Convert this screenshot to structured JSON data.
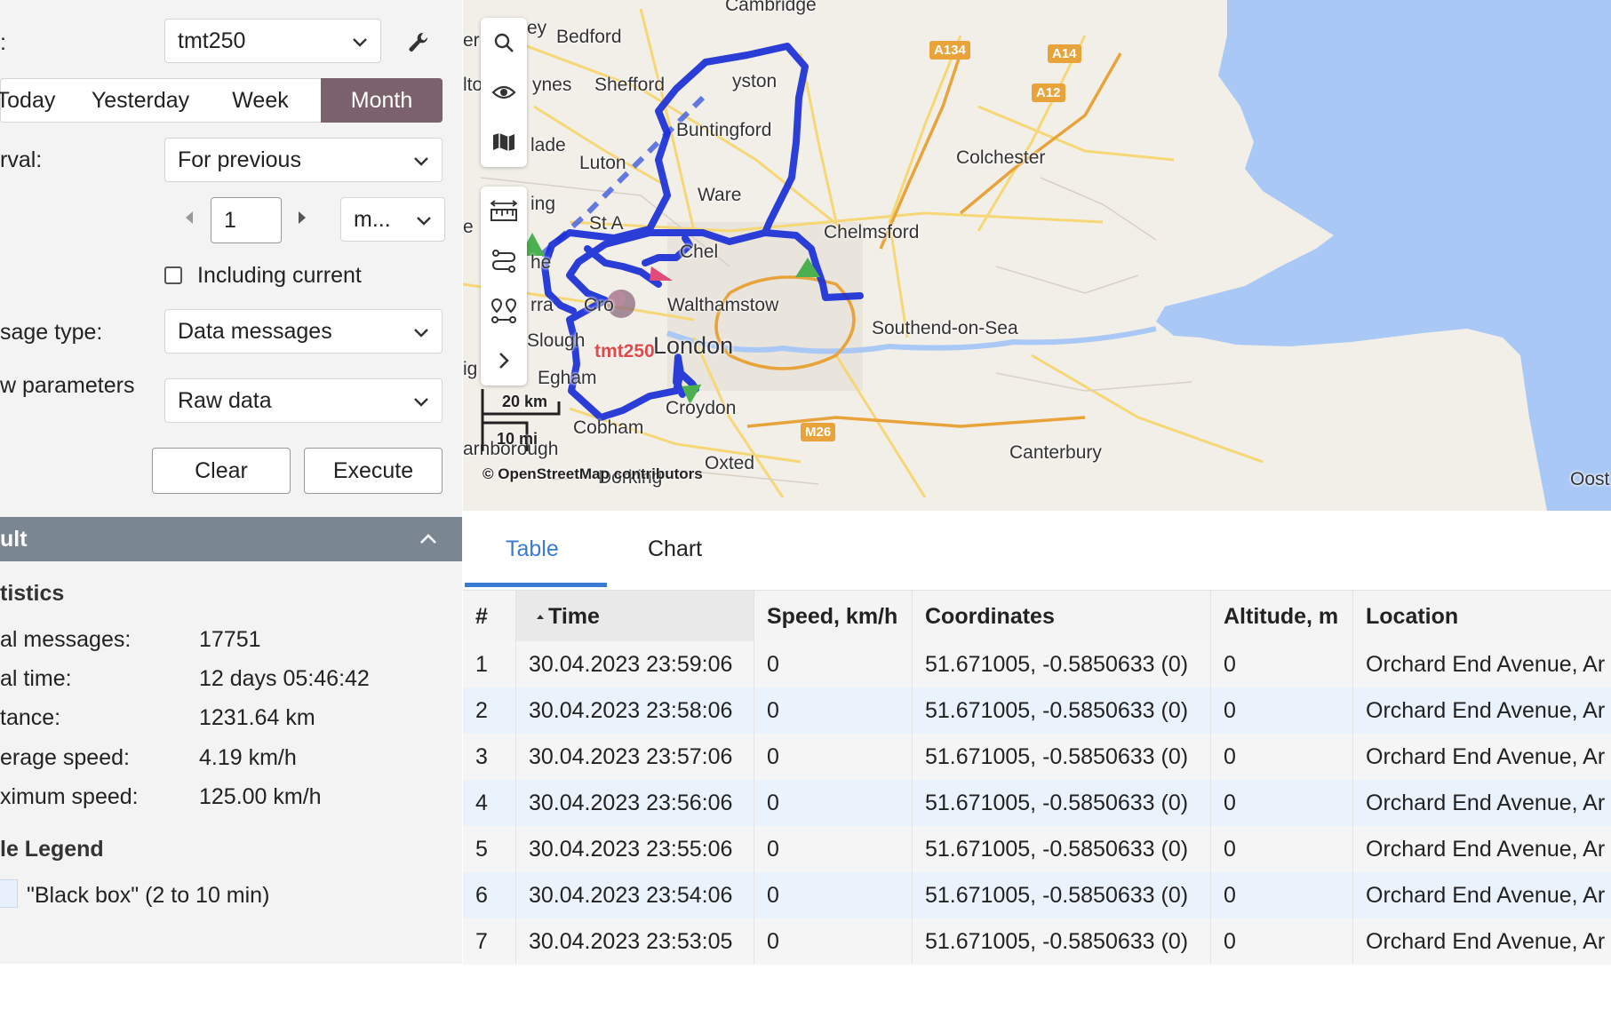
{
  "form": {
    "unit_label": ":",
    "unit_value": "tmt250",
    "tabs": [
      "Today",
      "Yesterday",
      "Week",
      "Month"
    ],
    "active_tab": "Month",
    "interval_label": "rval:",
    "interval_value": "For previous",
    "count_value": "1",
    "period_value": "m...",
    "including_current_label": "Including current",
    "message_type_label": "sage type:",
    "message_type_value": "Data messages",
    "show_parameters_label": "w parameters",
    "show_parameters_value": "Raw data",
    "clear_label": "Clear",
    "execute_label": "Execute"
  },
  "result": {
    "title": "ult",
    "statistics_title": "tistics",
    "stats": [
      {
        "label": "al messages:",
        "value": "17751"
      },
      {
        "label": "al time:",
        "value": "12 days 05:46:42"
      },
      {
        "label": "tance:",
        "value": "1231.64 km"
      },
      {
        "label": "erage speed:",
        "value": "4.19 km/h"
      },
      {
        "label": "ximum speed:",
        "value": "125.00 km/h"
      }
    ],
    "legend_title": "le Legend",
    "legend_item": "\"Black box\" (2 to 10 min)"
  },
  "map": {
    "places": [
      "Cambridge",
      "Bedford",
      "Shefford",
      "yston",
      "Buntingford",
      "Colchester",
      "Luton",
      "Ware",
      "Chelmsford",
      "St A",
      "Walthamstow",
      "Southend-on-Sea",
      "London",
      "Slough",
      "Egham",
      "Croydon",
      "Cobham",
      "Canterbury",
      "Oxted",
      "Dorking",
      "arnborough",
      "ynes",
      "lade",
      "ing",
      "Oost",
      "er",
      "lto",
      "e",
      "ig",
      "Cro",
      "rra",
      "he",
      "Chel",
      "ey"
    ],
    "roads": [
      "A134",
      "A14",
      "A12",
      "M26"
    ],
    "unit_marker_label": "tmt250",
    "scale_km": "20 km",
    "scale_mi": "10 mi",
    "attribution": "© OpenStreetMap contributors"
  },
  "tabs": {
    "items": [
      "Table",
      "Chart"
    ],
    "active": "Table"
  },
  "table": {
    "columns": [
      "#",
      "Time",
      "Speed, km/h",
      "Coordinates",
      "Altitude, m",
      "Location"
    ],
    "rows": [
      [
        "1",
        "30.04.2023 23:59:06",
        "0",
        "51.671005, -0.5850633 (0)",
        "0",
        "Orchard End Avenue, Ar"
      ],
      [
        "2",
        "30.04.2023 23:58:06",
        "0",
        "51.671005, -0.5850633 (0)",
        "0",
        "Orchard End Avenue, Ar"
      ],
      [
        "3",
        "30.04.2023 23:57:06",
        "0",
        "51.671005, -0.5850633 (0)",
        "0",
        "Orchard End Avenue, Ar"
      ],
      [
        "4",
        "30.04.2023 23:56:06",
        "0",
        "51.671005, -0.5850633 (0)",
        "0",
        "Orchard End Avenue, Ar"
      ],
      [
        "5",
        "30.04.2023 23:55:06",
        "0",
        "51.671005, -0.5850633 (0)",
        "0",
        "Orchard End Avenue, Ar"
      ],
      [
        "6",
        "30.04.2023 23:54:06",
        "0",
        "51.671005, -0.5850633 (0)",
        "0",
        "Orchard End Avenue, Ar"
      ],
      [
        "7",
        "30.04.2023 23:53:05",
        "0",
        "51.671005, -0.5850633 (0)",
        "0",
        "Orchard End Avenue, Ar"
      ]
    ]
  },
  "colors": {
    "accent": "#3a7bd5",
    "active_tab_bg": "#7b616b",
    "result_bar": "#7b8693",
    "track": "#1a2fd6",
    "sea": "#aac8f5"
  }
}
